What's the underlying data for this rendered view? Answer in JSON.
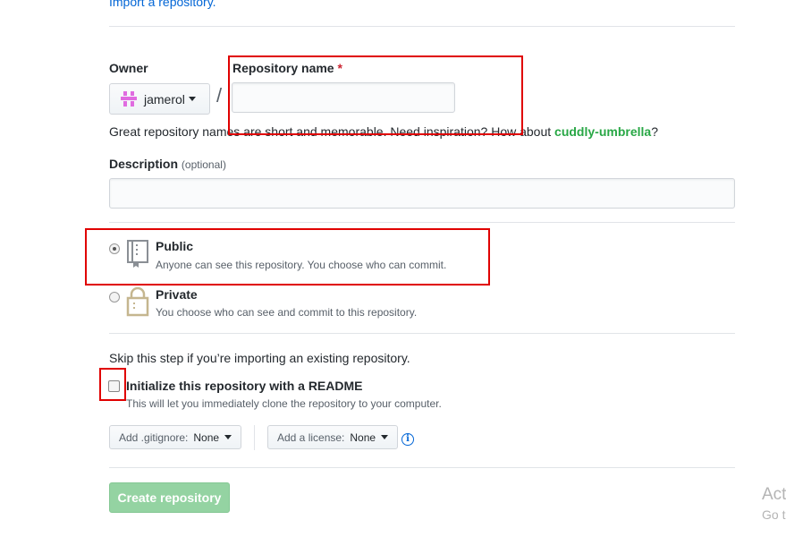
{
  "import_link": "Import a repository.",
  "owner": {
    "label": "Owner",
    "value": "jamerol"
  },
  "slash": "/",
  "repo_name": {
    "label": "Repository name",
    "required_mark": "*",
    "value": "",
    "help_prefix": "Great repository names are short and memorable. Need inspiration? How about ",
    "suggestion": "cuddly-umbrella",
    "help_suffix": "?"
  },
  "description": {
    "label": "Description",
    "optional": "(optional)",
    "value": ""
  },
  "visibility": {
    "selected": "public",
    "public": {
      "title": "Public",
      "desc": "Anyone can see this repository. You choose who can commit."
    },
    "private": {
      "title": "Private",
      "desc": "You choose who can see and commit to this repository."
    }
  },
  "init": {
    "skip_note": "Skip this step if you’re importing an existing repository.",
    "readme_label": "Initialize this repository with a README",
    "readme_desc": "This will let you immediately clone the repository to your computer.",
    "readme_checked": false
  },
  "gitignore": {
    "label": "Add .gitignore:",
    "value": "None"
  },
  "license": {
    "label": "Add a license:",
    "value": "None"
  },
  "info_icon": "i",
  "create_button": "Create repository",
  "watermark": {
    "line1": "Act",
    "line2": "Go t"
  },
  "colors": {
    "link": "#0366d6",
    "suggestion": "#28a745",
    "create_disabled": "#94d3a2",
    "annotation": "#e00000"
  }
}
